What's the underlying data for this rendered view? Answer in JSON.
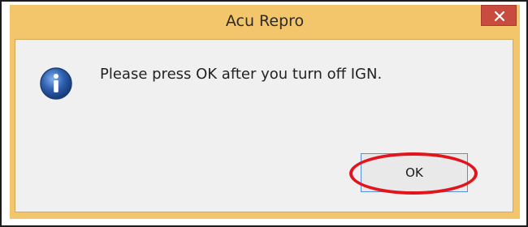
{
  "dialog": {
    "title": "Acu Repro",
    "message": "Please press OK after you turn off IGN.",
    "icon": "info-icon",
    "ok_label": "OK",
    "close_icon": "close-icon"
  },
  "colors": {
    "title_bar": "#f3c66b",
    "close_button": "#c94b3f",
    "client_area": "#f0f0f0",
    "highlight_ring": "#e2141c",
    "info_icon": "#2f5fae"
  }
}
